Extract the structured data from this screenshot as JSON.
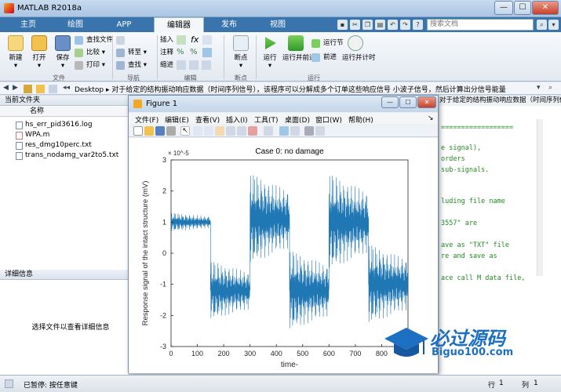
{
  "window": {
    "title": "MATLAB R2018a",
    "min": "—",
    "max": "☐",
    "close": "✕"
  },
  "tabs": [
    {
      "label": "主页"
    },
    {
      "label": "绘图"
    },
    {
      "label": "APP"
    },
    {
      "label": "编辑器"
    },
    {
      "label": "发布"
    },
    {
      "label": "视图"
    }
  ],
  "search_placeholder": "搜索文档",
  "ribbon": {
    "new": "新建",
    "open": "打开",
    "save": "保存",
    "find_files": "查找文件",
    "compare": "比较",
    "print": "打印",
    "goto": "转至",
    "find": "查找",
    "insert": "插入",
    "comment": "注释",
    "indent": "缩进",
    "breakpoints": "断点",
    "run": "运行",
    "run_advance": "运行并前进",
    "run_section": "运行节",
    "advance": "前进",
    "run_time": "运行并计时",
    "groups": {
      "file": "文件",
      "nav": "导航",
      "edit": "编辑",
      "bp": "断点",
      "run": "运行"
    }
  },
  "address": {
    "path": "Desktop  ▸  对于给定的结构振动响应数据（时间序列信号），该程序可以分解成多个订单这些响应信号 小波子信号，然后计算出分信号能量"
  },
  "current_folder": {
    "header": "当前文件夹",
    "column": "名称",
    "files": [
      {
        "name": "hs_err_pid3616.log"
      },
      {
        "name": "WPA.m"
      },
      {
        "name": "res_dmg10perc.txt"
      },
      {
        "name": "trans_nodamg_var2to5.txt"
      }
    ]
  },
  "details": {
    "header": "详细信息",
    "hint": "选择文件以查看详细信息"
  },
  "editor": {
    "tab_text": "对于给定的结构振动响应数据（时间序列信号），该程序可以...",
    "lines": [
      {
        "text": "=================="
      },
      {
        "text": "e signal),"
      },
      {
        "text": "orders"
      },
      {
        "text": " sub-signals."
      },
      {
        "text": "luding file name"
      },
      {
        "text": "3557\" are"
      },
      {
        "text": "ave as \"TXT\" file"
      },
      {
        "text": "re and save as"
      },
      {
        "text": "ace call M data file,"
      }
    ]
  },
  "figure": {
    "title": "Figure 1",
    "menus": [
      {
        "label": "文件(F)"
      },
      {
        "label": "编辑(E)"
      },
      {
        "label": "查看(V)"
      },
      {
        "label": "插入(I)"
      },
      {
        "label": "工具(T)"
      },
      {
        "label": "桌面(D)"
      },
      {
        "label": "窗口(W)"
      },
      {
        "label": "帮助(H)"
      }
    ]
  },
  "chart_data": {
    "type": "line",
    "title": "Case 0:  no damage",
    "xlabel": "time-",
    "ylabel": "Response signal of the intact structure (mV)",
    "y_exponent": "× 10^-5",
    "xlim": [
      0,
      900
    ],
    "ylim": [
      -3,
      3
    ],
    "xticks": [
      0,
      100,
      200,
      300,
      400,
      500,
      600,
      700,
      800
    ],
    "yticks": [
      3,
      2,
      1,
      0,
      -1,
      -2,
      -3
    ],
    "color": "#1f77b4",
    "segments": [
      {
        "x_start": 0,
        "x_end": 150,
        "level": 1.0,
        "amplitude": 0.35
      },
      {
        "x_start": 150,
        "x_end": 300,
        "level": -1.2,
        "amplitude": 1.1
      },
      {
        "x_start": 300,
        "x_end": 450,
        "level": 1.1,
        "amplitude": 1.7
      },
      {
        "x_start": 450,
        "x_end": 600,
        "level": -1.2,
        "amplitude": 1.5
      },
      {
        "x_start": 600,
        "x_end": 750,
        "level": 1.0,
        "amplitude": 1.8
      },
      {
        "x_start": 750,
        "x_end": 900,
        "level": -1.0,
        "amplitude": 1.5
      }
    ],
    "grid": false
  },
  "status": {
    "text": "已暂停: 按任意键",
    "row_label": "行",
    "row": "1",
    "col_label": "列",
    "col": "1"
  },
  "logo": {
    "cn": "必过源码",
    "en": "Biguo100.com"
  }
}
